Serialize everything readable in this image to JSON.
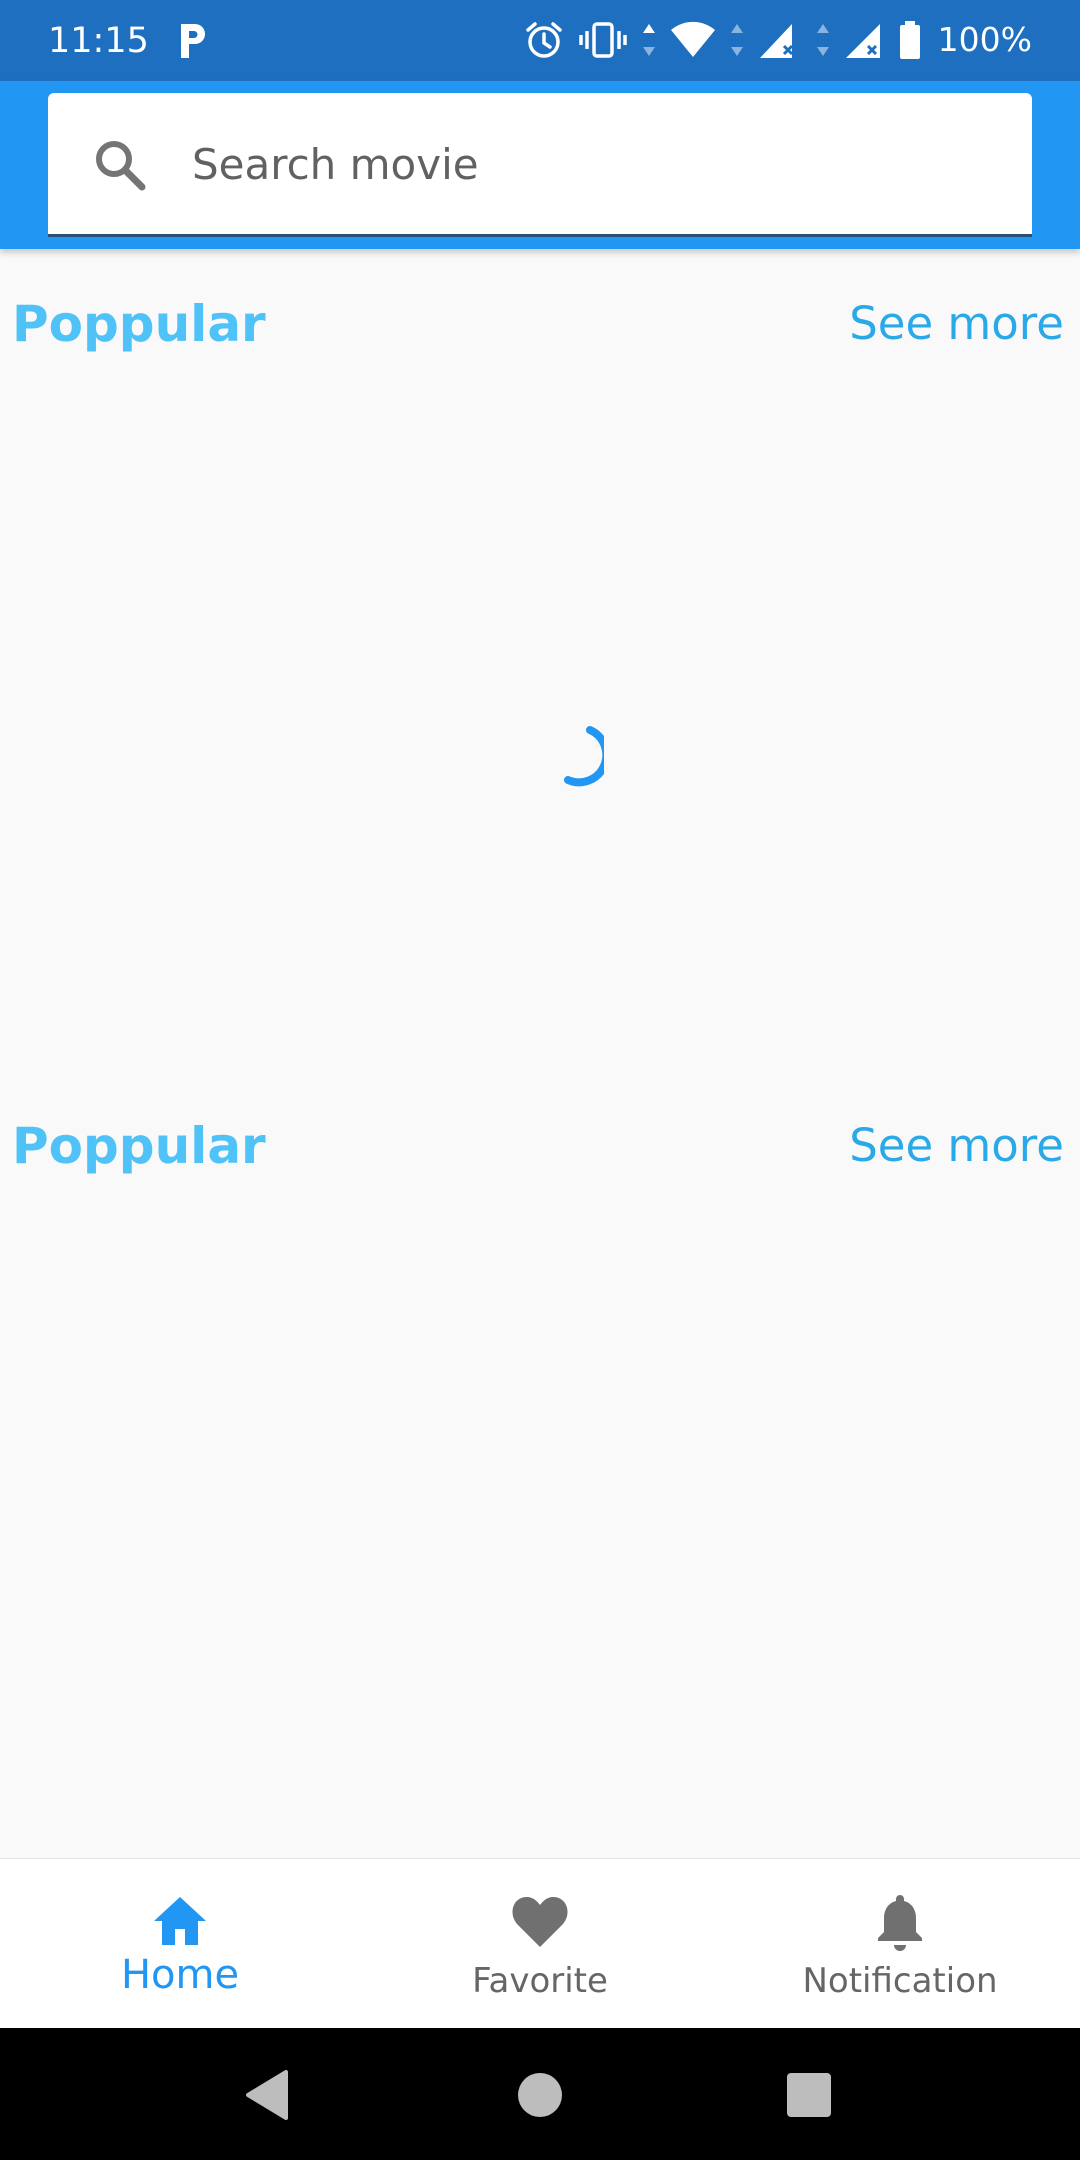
{
  "status_bar": {
    "time": "11:15",
    "battery": "100%",
    "icons": [
      "parking-icon",
      "alarm-icon",
      "vibrate-icon",
      "wifi-icon",
      "signal-icon",
      "signal-icon",
      "battery-icon"
    ]
  },
  "search": {
    "placeholder": "Search movie",
    "icon": "search-icon"
  },
  "sections": [
    {
      "title": "Poppular",
      "see_more": "See more",
      "loading": true
    },
    {
      "title": "Poppular",
      "see_more": "See more",
      "loading": false
    }
  ],
  "bottom_nav": {
    "items": [
      {
        "label": "Home",
        "icon": "home-icon",
        "active": true
      },
      {
        "label": "Favorite",
        "icon": "heart-icon",
        "active": false
      },
      {
        "label": "Notification",
        "icon": "bell-icon",
        "active": false
      }
    ]
  },
  "colors": {
    "status_bar": "#1e6fbf",
    "app_bar": "#2196f3",
    "section_title": "#4fc3f7",
    "see_more": "#29a9e8",
    "nav_active": "#2196f3",
    "nav_inactive": "#666666",
    "background": "#f9f9f9"
  }
}
